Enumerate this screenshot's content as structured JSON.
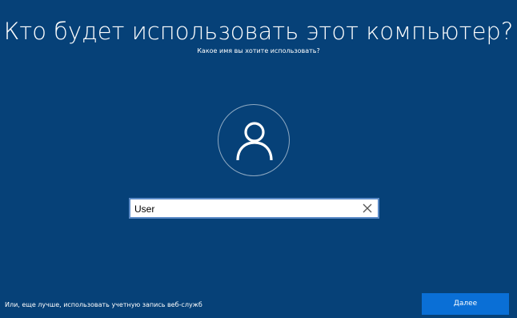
{
  "header": {
    "title": "Кто будет использовать этот компьютер?",
    "subtitle": "Какое имя вы хотите использовать?"
  },
  "avatar": {
    "icon": "user-icon"
  },
  "name_field": {
    "value": "User",
    "clear_icon": "close-icon"
  },
  "footer": {
    "online_account_link": "Или, еще лучше, использовать учетную запись веб-служб",
    "next_label": "Далее"
  },
  "colors": {
    "background": "#064178",
    "accent": "#0a6fd6",
    "input_border": "#5a8ac6"
  }
}
